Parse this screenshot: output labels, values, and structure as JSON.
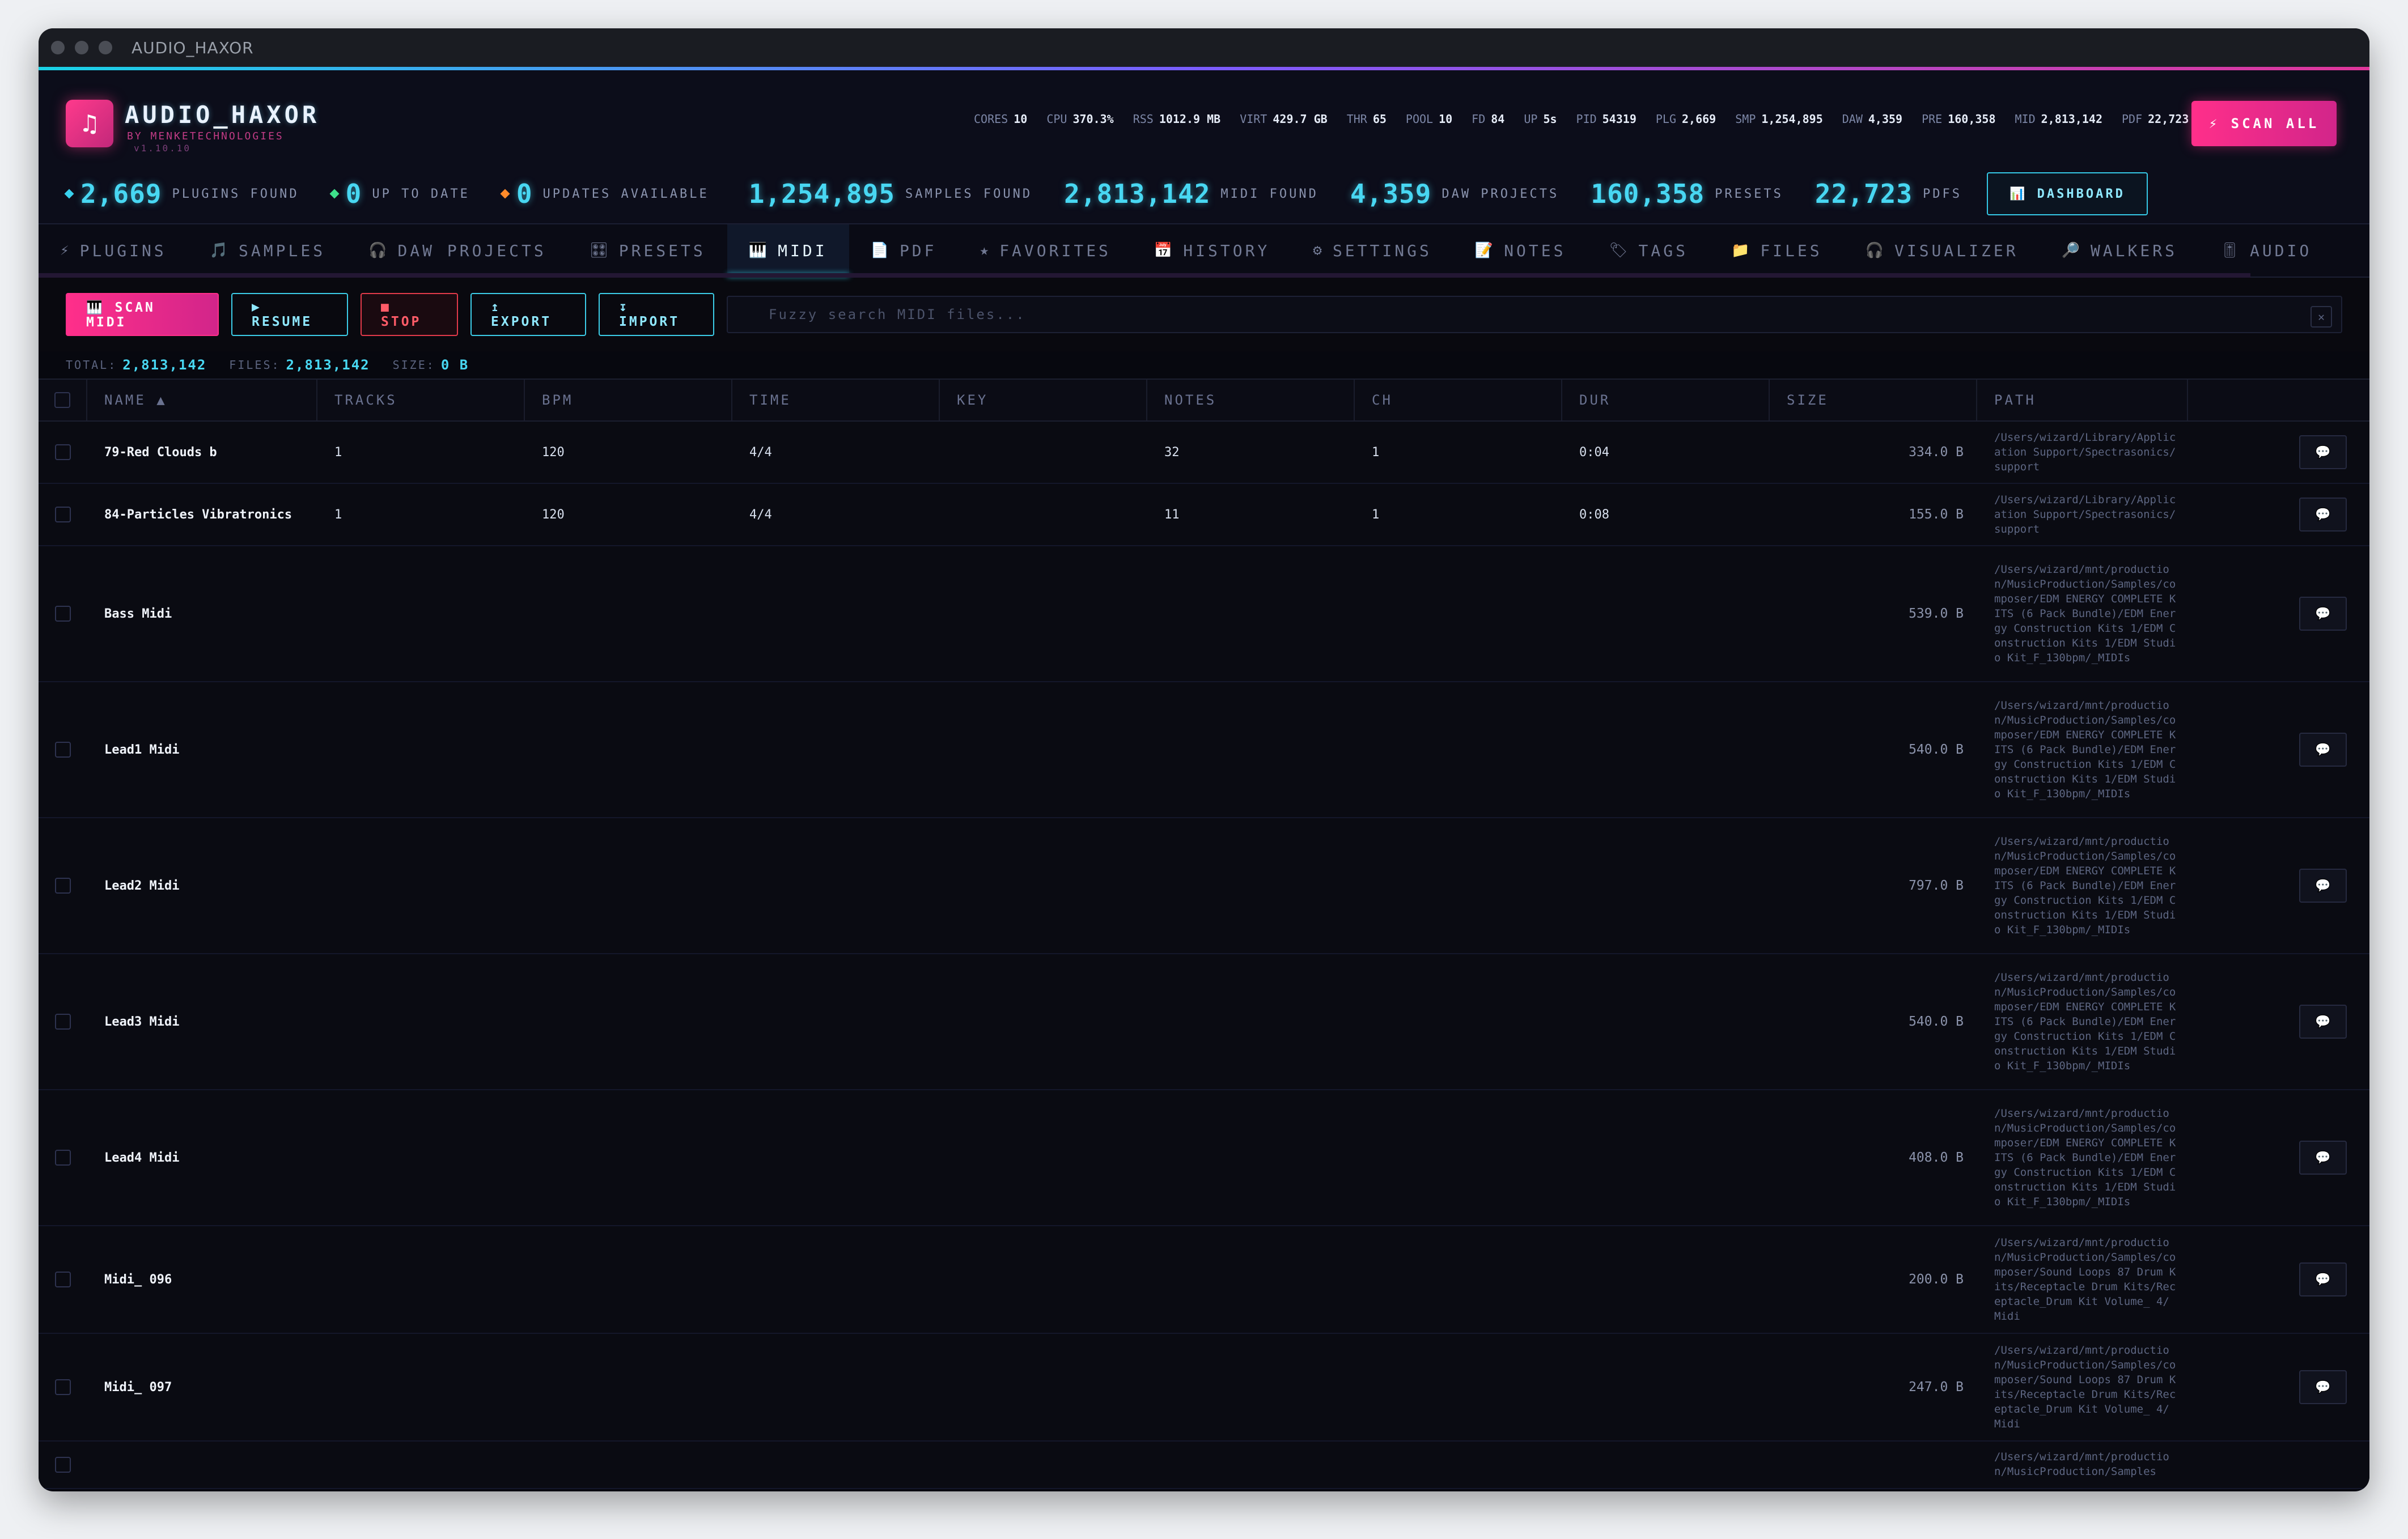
{
  "window": {
    "title": "AUDIO_HAXOR"
  },
  "app": {
    "name": "AUDIO_HAXOR",
    "by": "BY MENKETECHNOLOGIES",
    "version": "v1.10.10",
    "logo_glyph": "♫"
  },
  "sys": [
    {
      "k": "CORES",
      "v": "10"
    },
    {
      "k": "CPU",
      "v": "370.3%"
    },
    {
      "k": "RSS",
      "v": "1012.9 MB"
    },
    {
      "k": "VIRT",
      "v": "429.7 GB"
    },
    {
      "k": "THR",
      "v": "65"
    },
    {
      "k": "POOL",
      "v": "10"
    },
    {
      "k": "FD",
      "v": "84"
    },
    {
      "k": "UP",
      "v": "5s"
    },
    {
      "k": "PID",
      "v": "54319"
    },
    {
      "k": "PLG",
      "v": "2,669"
    },
    {
      "k": "SMP",
      "v": "1,254,895"
    },
    {
      "k": "DAW",
      "v": "4,359"
    },
    {
      "k": "PRE",
      "v": "160,358"
    },
    {
      "k": "MID",
      "v": "2,813,142"
    },
    {
      "k": "PDF",
      "v": "22,723"
    }
  ],
  "scan_all": "⚡ SCAN ALL",
  "counts": {
    "plugins": {
      "num": "2,669",
      "label": "PLUGINS FOUND"
    },
    "uptodate": {
      "num": "0",
      "label": "UP TO DATE"
    },
    "updates": {
      "num": "0",
      "label": "UPDATES AVAILABLE"
    },
    "samples": {
      "num": "1,254,895",
      "label": "SAMPLES FOUND"
    },
    "midi": {
      "num": "2,813,142",
      "label": "MIDI FOUND"
    },
    "daw": {
      "num": "4,359",
      "label": "DAW PROJECTS"
    },
    "presets": {
      "num": "160,358",
      "label": "PRESETS"
    },
    "pdfs": {
      "num": "22,723",
      "label": "PDFS"
    },
    "dashboard": "📊 DASHBOARD"
  },
  "tabs": [
    {
      "icon": "⚡",
      "label": "PLUGINS"
    },
    {
      "icon": "🎵",
      "label": "SAMPLES"
    },
    {
      "icon": "🎧",
      "label": "DAW PROJECTS"
    },
    {
      "icon": "🎛",
      "label": "PRESETS"
    },
    {
      "icon": "🎹",
      "label": "MIDI"
    },
    {
      "icon": "📄",
      "label": "PDF"
    },
    {
      "icon": "★",
      "label": "FAVORITES"
    },
    {
      "icon": "📅",
      "label": "HISTORY"
    },
    {
      "icon": "⚙",
      "label": "SETTINGS"
    },
    {
      "icon": "📝",
      "label": "NOTES"
    },
    {
      "icon": "🏷",
      "label": "TAGS"
    },
    {
      "icon": "📁",
      "label": "FILES"
    },
    {
      "icon": "🎧",
      "label": "VISUALIZER"
    },
    {
      "icon": "🔎",
      "label": "WALKERS"
    },
    {
      "icon": "🎚",
      "label": "AUDIO"
    }
  ],
  "toolbar": {
    "scan": "🎹 SCAN MIDI",
    "resume": "▶ RESUME",
    "stop": "■ STOP",
    "export": "↥ EXPORT",
    "import": "↧ IMPORT",
    "search_placeholder": "Fuzzy search MIDI files...",
    "clear": "✕"
  },
  "summary": {
    "total_label": "TOTAL:",
    "total": "2,813,142",
    "files_label": "FILES:",
    "files": "2,813,142",
    "size_label": "SIZE:",
    "size": "0 B"
  },
  "columns": [
    "NAME ▲",
    "TRACKS",
    "BPM",
    "TIME",
    "KEY",
    "NOTES",
    "CH",
    "DUR",
    "SIZE",
    "PATH"
  ],
  "rows": [
    {
      "name": "79-Red Clouds b",
      "tracks": "1",
      "bpm": "120",
      "time": "4/4",
      "key": "",
      "notes": "32",
      "ch": "1",
      "dur": "0:04",
      "size": "334.0 B",
      "path": "/Users/wizard/Library/Application Support/Spectrasonics/support"
    },
    {
      "name": "84-Particles Vibratronics",
      "tracks": "1",
      "bpm": "120",
      "time": "4/4",
      "key": "",
      "notes": "11",
      "ch": "1",
      "dur": "0:08",
      "size": "155.0 B",
      "path": "/Users/wizard/Library/Application Support/Spectrasonics/support"
    },
    {
      "name": "Bass Midi",
      "tracks": "",
      "bpm": "",
      "time": "",
      "key": "",
      "notes": "",
      "ch": "",
      "dur": "",
      "size": "539.0 B",
      "path": "/Users/wizard/mnt/production/MusicProduction/Samples/composer/EDM ENERGY COMPLETE KITS (6 Pack Bundle)/EDM Energy Construction Kits 1/EDM Construction Kits 1/EDM Studio Kit_F_130bpm/_MIDIs"
    },
    {
      "name": "Lead1 Midi",
      "tracks": "",
      "bpm": "",
      "time": "",
      "key": "",
      "notes": "",
      "ch": "",
      "dur": "",
      "size": "540.0 B",
      "path": "/Users/wizard/mnt/production/MusicProduction/Samples/composer/EDM ENERGY COMPLETE KITS (6 Pack Bundle)/EDM Energy Construction Kits 1/EDM Construction Kits 1/EDM Studio Kit_F_130bpm/_MIDIs"
    },
    {
      "name": "Lead2 Midi",
      "tracks": "",
      "bpm": "",
      "time": "",
      "key": "",
      "notes": "",
      "ch": "",
      "dur": "",
      "size": "797.0 B",
      "path": "/Users/wizard/mnt/production/MusicProduction/Samples/composer/EDM ENERGY COMPLETE KITS (6 Pack Bundle)/EDM Energy Construction Kits 1/EDM Construction Kits 1/EDM Studio Kit_F_130bpm/_MIDIs"
    },
    {
      "name": "Lead3 Midi",
      "tracks": "",
      "bpm": "",
      "time": "",
      "key": "",
      "notes": "",
      "ch": "",
      "dur": "",
      "size": "540.0 B",
      "path": "/Users/wizard/mnt/production/MusicProduction/Samples/composer/EDM ENERGY COMPLETE KITS (6 Pack Bundle)/EDM Energy Construction Kits 1/EDM Construction Kits 1/EDM Studio Kit_F_130bpm/_MIDIs"
    },
    {
      "name": "Lead4 Midi",
      "tracks": "",
      "bpm": "",
      "time": "",
      "key": "",
      "notes": "",
      "ch": "",
      "dur": "",
      "size": "408.0 B",
      "path": "/Users/wizard/mnt/production/MusicProduction/Samples/composer/EDM ENERGY COMPLETE KITS (6 Pack Bundle)/EDM Energy Construction Kits 1/EDM Construction Kits 1/EDM Studio Kit_F_130bpm/_MIDIs"
    },
    {
      "name": "Midi_ 096",
      "tracks": "",
      "bpm": "",
      "time": "",
      "key": "",
      "notes": "",
      "ch": "",
      "dur": "",
      "size": "200.0 B",
      "path": "/Users/wizard/mnt/production/MusicProduction/Samples/composer/Sound Loops 87 Drum Kits/Receptacle Drum Kits/Receptacle_Drum Kit Volume_ 4/ Midi"
    },
    {
      "name": "Midi_ 097",
      "tracks": "",
      "bpm": "",
      "time": "",
      "key": "",
      "notes": "",
      "ch": "",
      "dur": "",
      "size": "247.0 B",
      "path": "/Users/wizard/mnt/production/MusicProduction/Samples/composer/Sound Loops 87 Drum Kits/Receptacle Drum Kits/Receptacle_Drum Kit Volume_ 4/ Midi"
    },
    {
      "name": "",
      "tracks": "",
      "bpm": "",
      "time": "",
      "key": "",
      "notes": "",
      "ch": "",
      "dur": "",
      "size": "",
      "path": "/Users/wizard/mnt/production/MusicProduction/Samples"
    }
  ],
  "row_action_glyph": "💬",
  "colors": {
    "accent_cyan": "#48d7f2",
    "accent_pink": "#ff2f8a",
    "bg": "#07080f"
  }
}
